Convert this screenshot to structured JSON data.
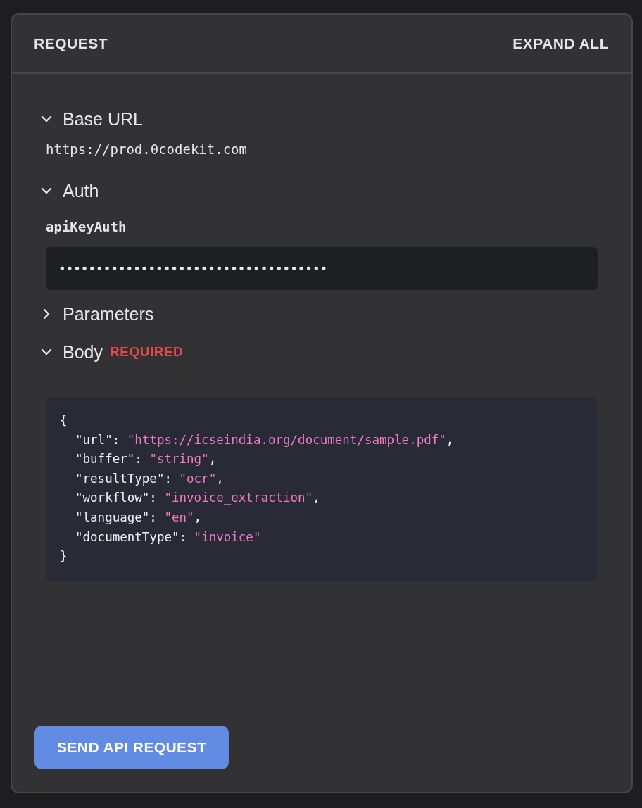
{
  "header": {
    "title": "REQUEST",
    "action": "EXPAND ALL"
  },
  "sections": [
    {
      "kind": "url",
      "label": "Base URL",
      "expanded": true,
      "value": "https://prod.0codekit.com"
    },
    {
      "kind": "auth",
      "label": "Auth",
      "expanded": true,
      "field_label": "apiKeyAuth",
      "value": "••••••••••••••••••••••••••••••••••••"
    },
    {
      "label": "Parameters",
      "expanded": false
    },
    {
      "kind": "code",
      "label": "Body",
      "expanded": true,
      "badge": "REQUIRED",
      "lines": [
        {
          "open": "{"
        },
        {
          "key": "\"url\":",
          "value": "\"https://icseindia.org/document/sample.pdf\"",
          "comma": ","
        },
        {
          "key": "\"buffer\":",
          "value": "\"string\"",
          "comma": ","
        },
        {
          "key": "\"resultType\":",
          "value": "\"ocr\"",
          "comma": ","
        },
        {
          "key": "\"workflow\":",
          "value": "\"invoice_extraction\"",
          "comma": ","
        },
        {
          "key": "\"language\":",
          "value": "\"en\"",
          "comma": ","
        },
        {
          "key": "\"documentType\":",
          "value": "\"invoice\""
        },
        {
          "open": "}"
        }
      ]
    }
  ],
  "send_button": "SEND API REQUEST"
}
